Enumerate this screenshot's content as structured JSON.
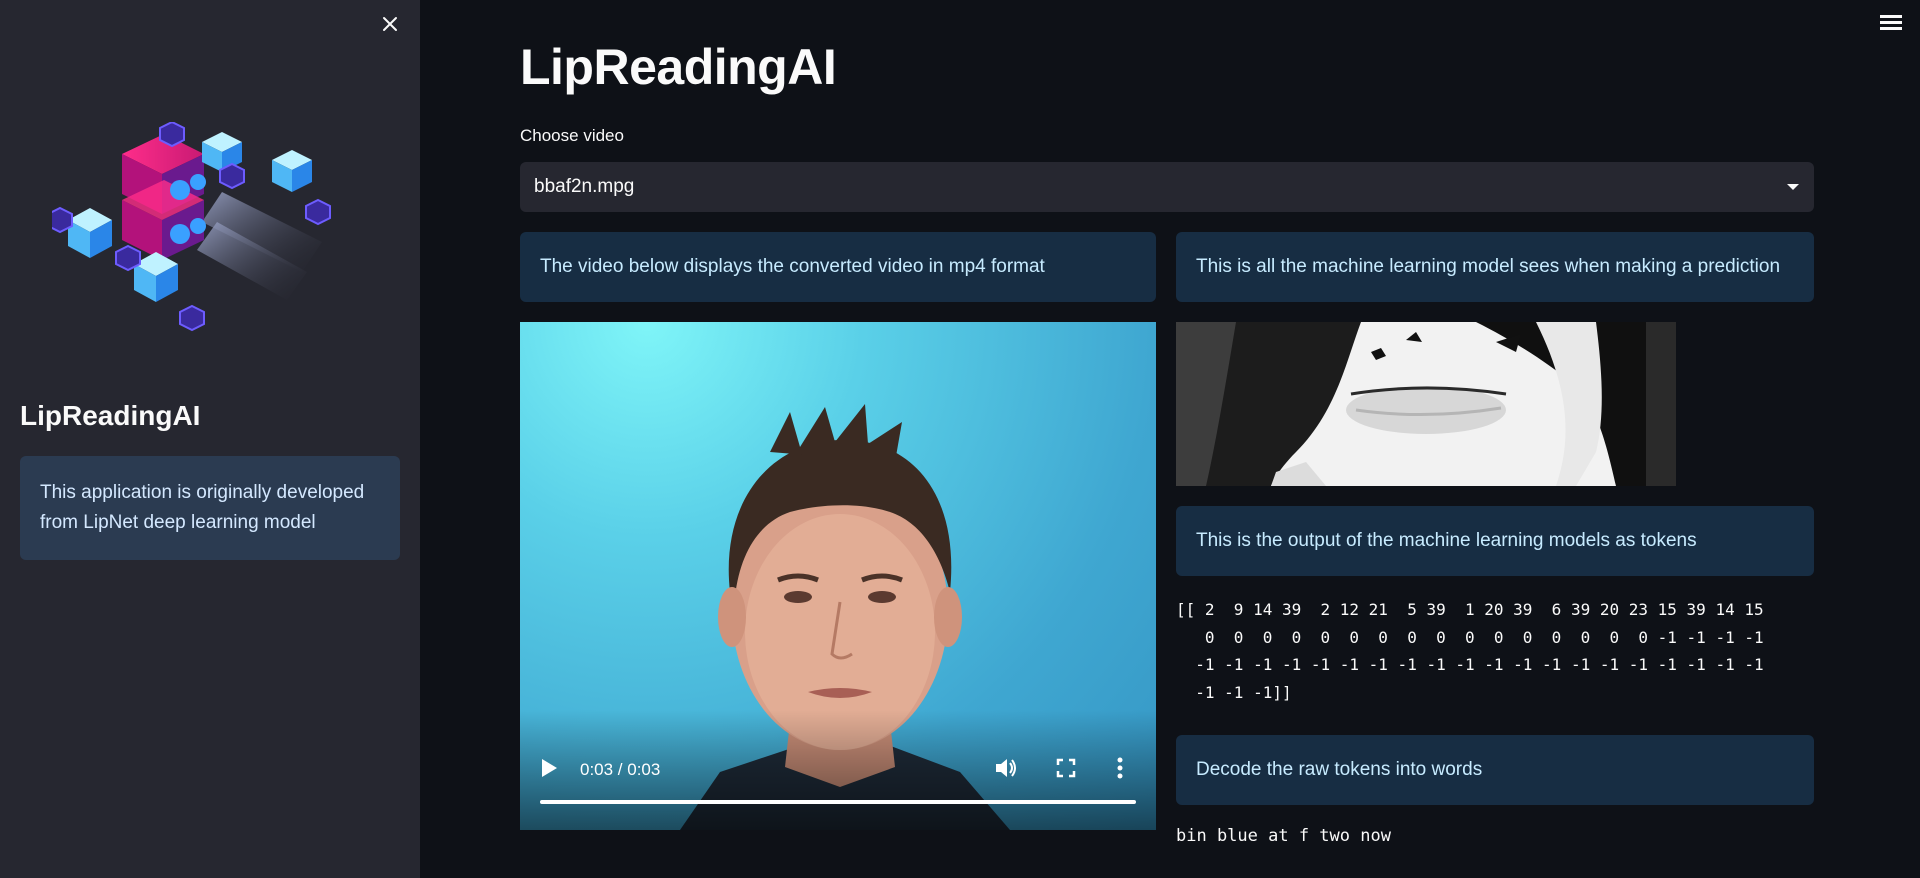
{
  "sidebar": {
    "close_icon": "close-icon",
    "title": "LipReadingAI",
    "info": "This application is originally developed from LipNet deep learning model"
  },
  "header": {
    "menu_icon": "hamburger-menu-icon"
  },
  "main": {
    "title": "LipReadingAI",
    "select": {
      "label": "Choose video",
      "value": "bbaf2n.mpg"
    },
    "left_info": "The video below displays the converted video in mp4 format",
    "right_info_1": "This is all the machine learning model sees when making a prediction",
    "right_info_2": "This is the output of the machine learning models as tokens",
    "right_info_3": "Decode the raw tokens into words",
    "video": {
      "time": "0:03 / 0:03",
      "progress": 1.0
    },
    "tokens": "[[ 2  9 14 39  2 12 21  5 39  1 20 39  6 39 20 23 15 39 14 15\n   0  0  0  0  0  0  0  0  0  0  0  0  0  0  0  0 -1 -1 -1 -1\n  -1 -1 -1 -1 -1 -1 -1 -1 -1 -1 -1 -1 -1 -1 -1 -1 -1 -1 -1 -1\n  -1 -1 -1]]",
    "decoded": "bin blue at f two now"
  },
  "colors": {
    "background": "#0e1117",
    "sidebar": "#262730",
    "info_box": "#172d43",
    "info_text": "#c7ebff",
    "sidebar_info_box": "#2b3b51"
  }
}
